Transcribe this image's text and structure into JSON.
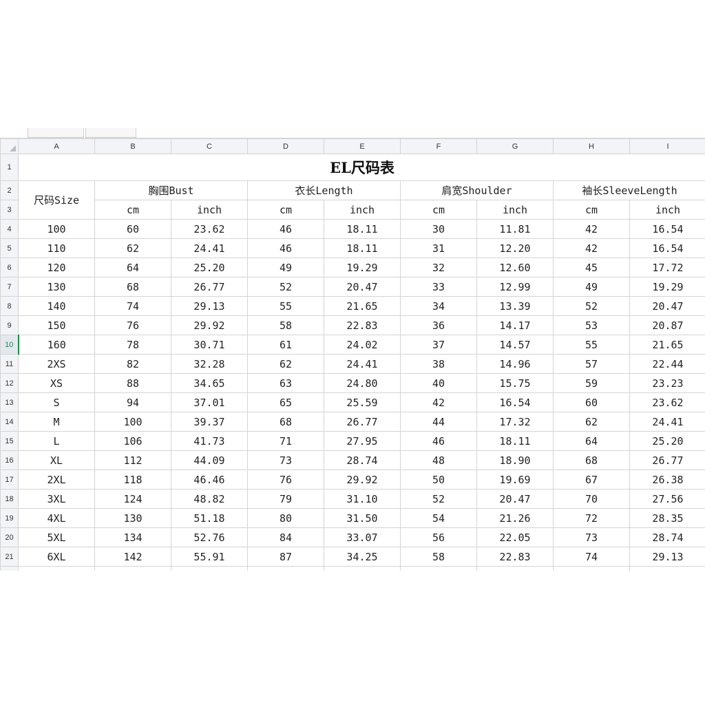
{
  "column_headers": [
    "A",
    "B",
    "C",
    "D",
    "E",
    "F",
    "G",
    "H",
    "I"
  ],
  "row_numbers": [
    "1",
    "2",
    "3",
    "4",
    "5",
    "6",
    "7",
    "8",
    "9",
    "10",
    "11",
    "12",
    "13",
    "14",
    "15",
    "16",
    "17",
    "18",
    "19",
    "20",
    "21"
  ],
  "active_row": "10",
  "sheet": {
    "title": "EL尺码表",
    "size_header": "尺码Size",
    "groups": [
      "胸围Bust",
      "衣长Length",
      "肩宽Shoulder",
      "袖长SleeveLength"
    ],
    "units": [
      "cm",
      "inch",
      "cm",
      "inch",
      "cm",
      "inch",
      "cm",
      "inch"
    ],
    "rows": [
      [
        "100",
        "60",
        "23.62",
        "46",
        "18.11",
        "30",
        "11.81",
        "42",
        "16.54"
      ],
      [
        "110",
        "62",
        "24.41",
        "46",
        "18.11",
        "31",
        "12.20",
        "42",
        "16.54"
      ],
      [
        "120",
        "64",
        "25.20",
        "49",
        "19.29",
        "32",
        "12.60",
        "45",
        "17.72"
      ],
      [
        "130",
        "68",
        "26.77",
        "52",
        "20.47",
        "33",
        "12.99",
        "49",
        "19.29"
      ],
      [
        "140",
        "74",
        "29.13",
        "55",
        "21.65",
        "34",
        "13.39",
        "52",
        "20.47"
      ],
      [
        "150",
        "76",
        "29.92",
        "58",
        "22.83",
        "36",
        "14.17",
        "53",
        "20.87"
      ],
      [
        "160",
        "78",
        "30.71",
        "61",
        "24.02",
        "37",
        "14.57",
        "55",
        "21.65"
      ],
      [
        "2XS",
        "82",
        "32.28",
        "62",
        "24.41",
        "38",
        "14.96",
        "57",
        "22.44"
      ],
      [
        "XS",
        "88",
        "34.65",
        "63",
        "24.80",
        "40",
        "15.75",
        "59",
        "23.23"
      ],
      [
        "S",
        "94",
        "37.01",
        "65",
        "25.59",
        "42",
        "16.54",
        "60",
        "23.62"
      ],
      [
        "M",
        "100",
        "39.37",
        "68",
        "26.77",
        "44",
        "17.32",
        "62",
        "24.41"
      ],
      [
        "L",
        "106",
        "41.73",
        "71",
        "27.95",
        "46",
        "18.11",
        "64",
        "25.20"
      ],
      [
        "XL",
        "112",
        "44.09",
        "73",
        "28.74",
        "48",
        "18.90",
        "68",
        "26.77"
      ],
      [
        "2XL",
        "118",
        "46.46",
        "76",
        "29.92",
        "50",
        "19.69",
        "67",
        "26.38"
      ],
      [
        "3XL",
        "124",
        "48.82",
        "79",
        "31.10",
        "52",
        "20.47",
        "70",
        "27.56"
      ],
      [
        "4XL",
        "130",
        "51.18",
        "80",
        "31.50",
        "54",
        "21.26",
        "72",
        "28.35"
      ],
      [
        "5XL",
        "134",
        "52.76",
        "84",
        "33.07",
        "56",
        "22.05",
        "73",
        "28.74"
      ],
      [
        "6XL",
        "142",
        "55.91",
        "87",
        "34.25",
        "58",
        "22.83",
        "74",
        "29.13"
      ]
    ]
  },
  "colors": {
    "active_row_accent": "#1f8a4c",
    "header_bg": "#f2f4f7",
    "gridline": "#d4d4d4"
  }
}
